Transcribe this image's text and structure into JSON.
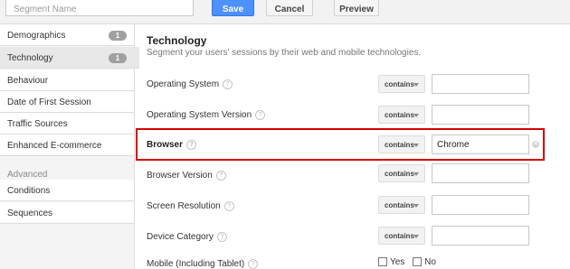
{
  "toolbar": {
    "segment_placeholder": "Segment Name",
    "save_label": "Save",
    "cancel_label": "Cancel",
    "preview_label": "Preview"
  },
  "sidebar": {
    "items": [
      {
        "label": "Demographics",
        "badge": "1"
      },
      {
        "label": "Technology",
        "badge": "1"
      },
      {
        "label": "Behaviour"
      },
      {
        "label": "Date of First Session"
      },
      {
        "label": "Traffic Sources"
      },
      {
        "label": "Enhanced E-commerce"
      }
    ],
    "advanced_heading": "Advanced",
    "advanced_items": [
      {
        "label": "Conditions"
      },
      {
        "label": "Sequences"
      }
    ]
  },
  "main": {
    "title": "Technology",
    "subtitle": "Segment your users' sessions by their web and mobile technologies.",
    "help_glyph": "?",
    "clear_glyph": "✕",
    "rows": [
      {
        "label": "Operating System",
        "operator": "contains",
        "value": ""
      },
      {
        "label": "Operating System Version",
        "operator": "contains",
        "value": ""
      },
      {
        "label": "Browser",
        "operator": "contains",
        "value": "Chrome"
      },
      {
        "label": "Browser Version",
        "operator": "contains",
        "value": ""
      },
      {
        "label": "Screen Resolution",
        "operator": "contains",
        "value": ""
      },
      {
        "label": "Device Category",
        "operator": "contains",
        "value": ""
      },
      {
        "label": "Mobile (Including Tablet)"
      }
    ],
    "mobile_yes": "Yes",
    "mobile_no": "No"
  }
}
